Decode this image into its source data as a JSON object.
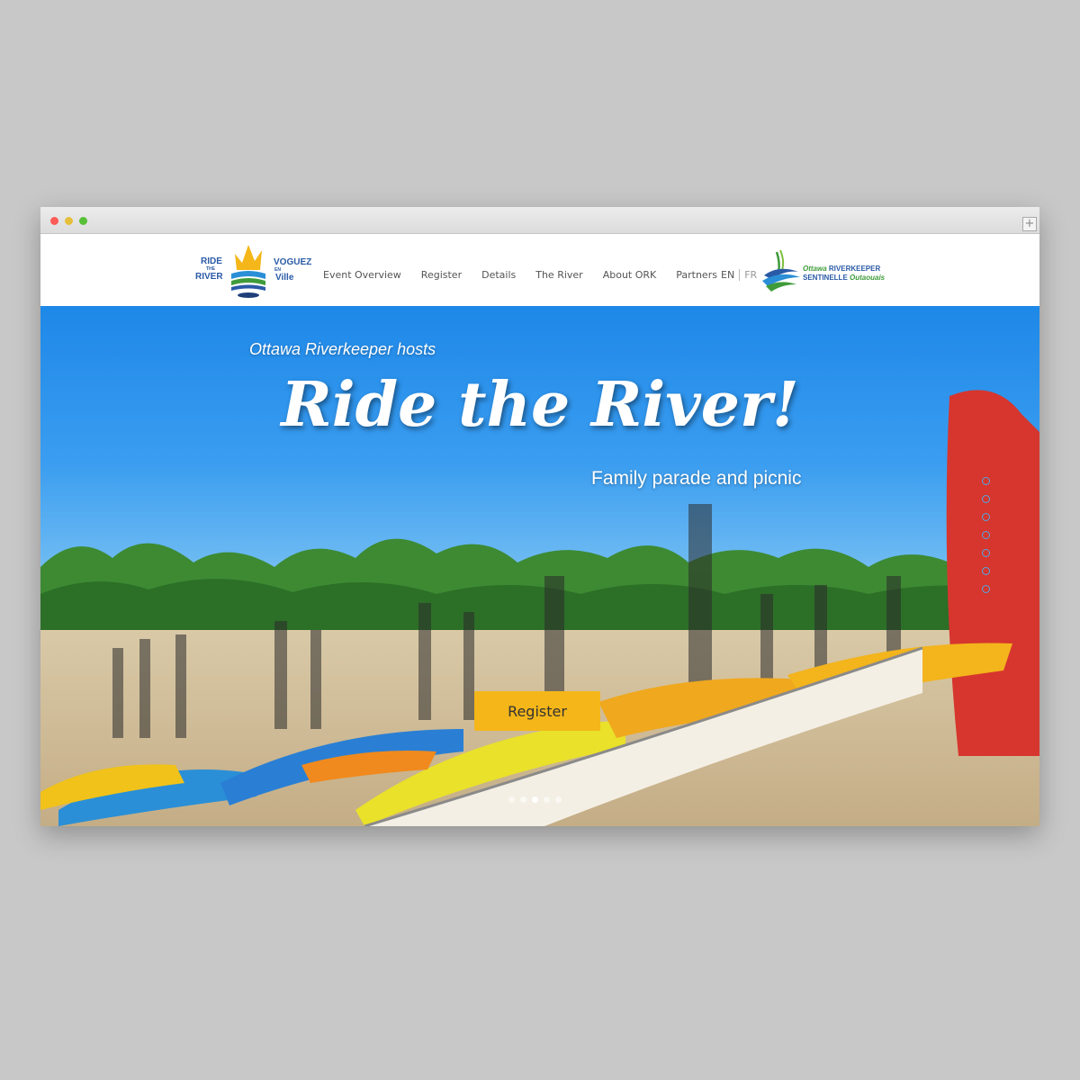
{
  "logo": {
    "ride": "RIDE",
    "the": "THE",
    "river": "RIVER",
    "voguez": "VOGUEZ",
    "en": "EN",
    "ville": "Ville"
  },
  "nav": {
    "items": [
      {
        "label": "Event Overview"
      },
      {
        "label": "Register"
      },
      {
        "label": "Details"
      },
      {
        "label": "The River"
      },
      {
        "label": "About ORK"
      },
      {
        "label": "Partners"
      }
    ],
    "lang_en": "EN",
    "lang_fr": "FR"
  },
  "partner_logo": {
    "line1_a": "Ottawa",
    "line1_b": "RIVERKEEPER",
    "line2_a": "SENTINELLE",
    "line2_b": "Outaouais"
  },
  "hero": {
    "pretitle": "Ottawa Riverkeeper hosts",
    "title": "Ride the River!",
    "subtitle": "Family parade and picnic",
    "register_label": "Register",
    "slides_total": 5,
    "slide_active": 3
  },
  "colors": {
    "accent": "#f4b619",
    "brand_blue": "#2a5aa6",
    "brand_green": "#3f9b3a"
  }
}
